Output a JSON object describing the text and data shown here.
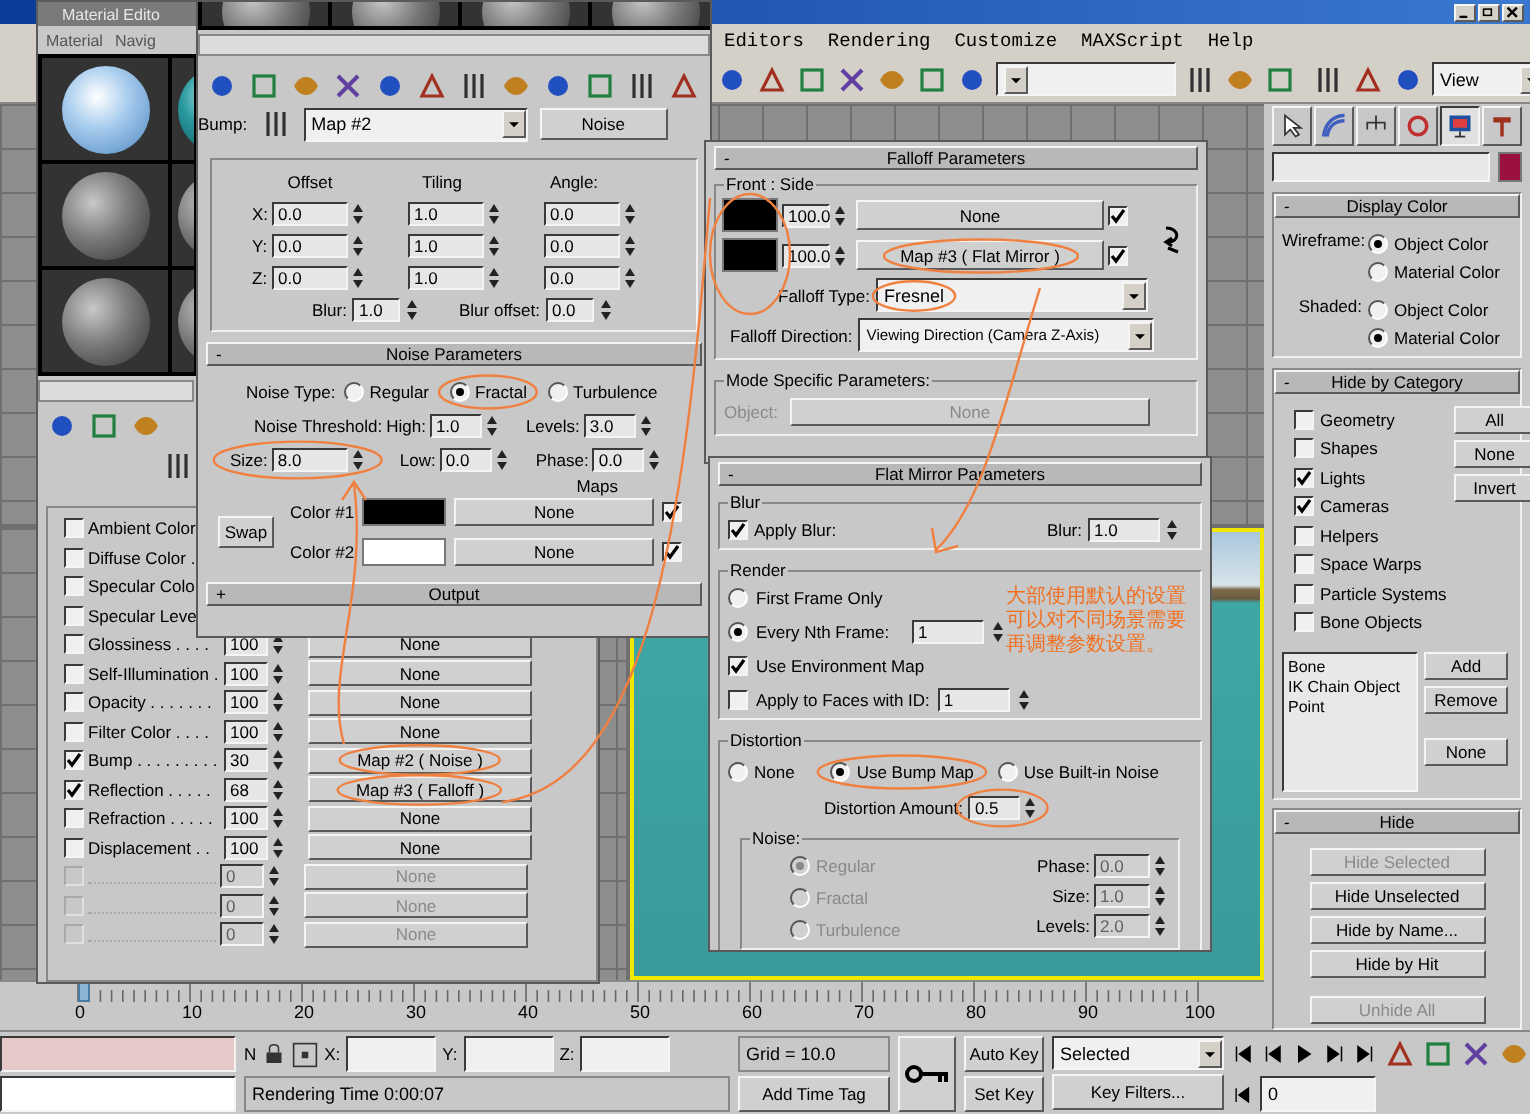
{
  "main_window": {
    "menu": [
      "Editors",
      "Rendering",
      "Customize",
      "MAXScript",
      "Help"
    ],
    "view_dropdown": "View"
  },
  "material_editor": {
    "title": "Material Edito",
    "menu": [
      "Material",
      "Navig"
    ],
    "maps": [
      {
        "label": "Ambient Color",
        "checked": false,
        "disabled": false
      },
      {
        "label": "Diffuse Color .",
        "checked": false,
        "disabled": false
      },
      {
        "label": "Specular Colo",
        "checked": false,
        "disabled": false
      },
      {
        "label": "Specular Leve",
        "checked": false,
        "disabled": false
      },
      {
        "label": "Glossiness . . . .",
        "checked": false,
        "disabled": false,
        "amount": "100",
        "map": "None",
        "circled": false
      },
      {
        "label": "Self-Illumination .",
        "checked": false,
        "disabled": false,
        "amount": "100",
        "map": "None",
        "circled": false
      },
      {
        "label": "Opacity . . . . . . .",
        "checked": false,
        "disabled": false,
        "amount": "100",
        "map": "None",
        "circled": false
      },
      {
        "label": "Filter Color . . . .",
        "checked": false,
        "disabled": false,
        "amount": "100",
        "map": "None",
        "circled": false
      },
      {
        "label": "Bump . . . . . . . . .",
        "checked": true,
        "disabled": false,
        "amount": "30",
        "map": "Map #2  ( Noise )",
        "circled": true
      },
      {
        "label": "Reflection . . . . .",
        "checked": true,
        "disabled": false,
        "amount": "68",
        "map": "Map #3  ( Falloff )",
        "circled": true
      },
      {
        "label": "Refraction . . . . .",
        "checked": false,
        "disabled": false,
        "amount": "100",
        "map": "None",
        "circled": false
      },
      {
        "label": "Displacement . .",
        "checked": false,
        "disabled": false,
        "amount": "100",
        "map": "None",
        "circled": false
      },
      {
        "checked": false,
        "disabled": true,
        "amount": "0",
        "map": "None",
        "circled": false
      },
      {
        "checked": false,
        "disabled": true,
        "amount": "0",
        "map": "None",
        "circled": false
      },
      {
        "checked": false,
        "disabled": true,
        "amount": "0",
        "map": "None",
        "circled": false
      }
    ]
  },
  "noise_map": {
    "bump": {
      "label": "Bump:",
      "map_name": "Map #2",
      "type_button": "Noise"
    },
    "coordinates": {
      "headers": [
        "Offset",
        "Tiling",
        "Angle:"
      ],
      "rows": [
        {
          "axis": "X:",
          "values": [
            "0.0",
            "1.0",
            "0.0"
          ]
        },
        {
          "axis": "Y:",
          "values": [
            "0.0",
            "1.0",
            "0.0"
          ]
        },
        {
          "axis": "Z:",
          "values": [
            "0.0",
            "1.0",
            "0.0"
          ]
        }
      ],
      "blur": {
        "label": "Blur:",
        "value": "1.0"
      },
      "blur_offset": {
        "label": "Blur offset:",
        "value": "0.0"
      }
    },
    "noise_parameters": {
      "toggle": "-",
      "title": "Noise Parameters",
      "type_label": "Noise Type:",
      "types": [
        {
          "label": "Regular",
          "selected": false,
          "circled": false
        },
        {
          "label": "Fractal",
          "selected": true,
          "circled": true
        },
        {
          "label": "Turbulence",
          "selected": false,
          "circled": false
        }
      ],
      "threshold_label": "Noise Threshold:",
      "high": {
        "label": "High:",
        "value": "1.0"
      },
      "levels": {
        "label": "Levels:",
        "value": "3.0"
      },
      "size": {
        "label": "Size:",
        "value": "8.0",
        "circled": true
      },
      "low": {
        "label": "Low:",
        "value": "0.0"
      },
      "phase": {
        "label": "Phase:",
        "value": "0.0"
      },
      "maps_label": "Maps",
      "swap": "Swap",
      "colors": [
        {
          "label": "Color #1",
          "color": "#000000",
          "map": "None",
          "checked": true
        },
        {
          "label": "Color #2",
          "color": "#ffffff",
          "map": "None",
          "checked": true
        }
      ]
    },
    "output": {
      "toggle": "+",
      "title": "Output"
    }
  },
  "falloff": {
    "toggle": "-",
    "title": "Falloff Parameters",
    "group": "Front : Side",
    "rows": [
      {
        "color": "#000000",
        "value": "100.0",
        "map": "None",
        "checked": true,
        "circled": false
      },
      {
        "color": "#000000",
        "value": "100.0",
        "map": "Map #3  ( Flat Mirror )",
        "checked": true,
        "circled": true
      }
    ],
    "type": {
      "label": "Falloff Type:",
      "value": "Fresnel",
      "circled": true
    },
    "direction": {
      "label": "Falloff Direction:",
      "value": "Viewing Direction (Camera Z-Axis)"
    },
    "mode": {
      "title": "Mode Specific Parameters:",
      "object_label": "Object:",
      "object_button": "None"
    }
  },
  "flat_mirror": {
    "toggle": "-",
    "title": "Flat Mirror Parameters",
    "blur": {
      "title": "Blur",
      "apply": {
        "label": "Apply Blur:",
        "checked": true
      },
      "amount": {
        "label": "Blur:",
        "value": "1.0"
      }
    },
    "render": {
      "title": "Render",
      "modes": [
        {
          "label": "First Frame Only",
          "selected": false
        },
        {
          "label": "Every Nth Frame:",
          "selected": true,
          "value": "1"
        }
      ],
      "env_map": {
        "label": "Use Environment Map",
        "checked": true
      },
      "faces": {
        "label": "Apply to Faces with ID:",
        "checked": false,
        "value": "1"
      }
    },
    "distortion": {
      "title": "Distortion",
      "modes": [
        {
          "label": "None",
          "selected": false,
          "circled": false
        },
        {
          "label": "Use Bump Map",
          "selected": true,
          "circled": true
        },
        {
          "label": "Use Built-in Noise",
          "selected": false,
          "circled": false
        }
      ],
      "amount": {
        "label": "Distortion Amount:",
        "value": "0.5",
        "circled": true
      },
      "noise": {
        "title": "Noise:",
        "types": [
          {
            "label": "Regular",
            "selected": true
          },
          {
            "label": "Fractal",
            "selected": false
          },
          {
            "label": "Turbulence",
            "selected": false
          }
        ],
        "fields": [
          {
            "label": "Phase:",
            "value": "0.0"
          },
          {
            "label": "Size:",
            "value": "1.0"
          },
          {
            "label": "Levels:",
            "value": "2.0"
          }
        ]
      }
    }
  },
  "command_panel": {
    "tabs": [
      {
        "selected": false
      },
      {
        "selected": false
      },
      {
        "selected": false
      },
      {
        "selected": false
      },
      {
        "selected": true
      },
      {
        "selected": false
      }
    ],
    "display_color": {
      "toggle": "-",
      "title": "Display Color",
      "groups": [
        {
          "label": "Wireframe:",
          "options": [
            {
              "label": "Object Color",
              "selected": true
            },
            {
              "label": "Material Color",
              "selected": false
            }
          ]
        },
        {
          "label": "Shaded:",
          "options": [
            {
              "label": "Object Color",
              "selected": false
            },
            {
              "label": "Material Color",
              "selected": true
            }
          ]
        }
      ]
    },
    "hide_by_category": {
      "toggle": "-",
      "title": "Hide by Category",
      "items": [
        {
          "label": "Geometry",
          "checked": false
        },
        {
          "label": "Shapes",
          "checked": false
        },
        {
          "label": "Lights",
          "checked": true
        },
        {
          "label": "Cameras",
          "checked": true
        },
        {
          "label": "Helpers",
          "checked": false
        },
        {
          "label": "Space Warps",
          "checked": false
        },
        {
          "label": "Particle Systems",
          "checked": false
        },
        {
          "label": "Bone Objects",
          "checked": false
        }
      ],
      "buttons": [
        "All",
        "None",
        "Invert"
      ],
      "list": [
        "Bone",
        "IK Chain Object",
        "Point"
      ],
      "list_buttons": [
        "Add",
        "Remove",
        "None"
      ]
    },
    "hide": {
      "toggle": "-",
      "title": "Hide",
      "buttons": [
        {
          "label": "Hide Selected",
          "disabled": true
        },
        {
          "label": "Hide Unselected",
          "disabled": false
        },
        {
          "label": "Hide by Name...",
          "disabled": false
        },
        {
          "label": "Hide by Hit",
          "disabled": false
        },
        {
          "label": "Unhide All",
          "disabled": true
        }
      ]
    }
  },
  "timeline": {
    "labels": [
      "0",
      "10",
      "20",
      "30",
      "40",
      "50",
      "60",
      "70",
      "80",
      "90",
      "100"
    ],
    "level": 0
  },
  "status_bar": {
    "n": "N",
    "x": "X:",
    "y": "Y:",
    "z": "Z:",
    "rendering_time": "Rendering Time  0:00:07",
    "grid": "Grid = 10.0",
    "add_time_tag": "Add Time Tag",
    "auto_key": "Auto Key",
    "set_key": "Set Key",
    "key_mode": "Selected",
    "key_filters": "Key Filters...",
    "frame": "0"
  },
  "annotation": {
    "note": [
      "大部使用默认的设置",
      "可以对不同场景需要",
      "再调整参数设置。"
    ]
  }
}
